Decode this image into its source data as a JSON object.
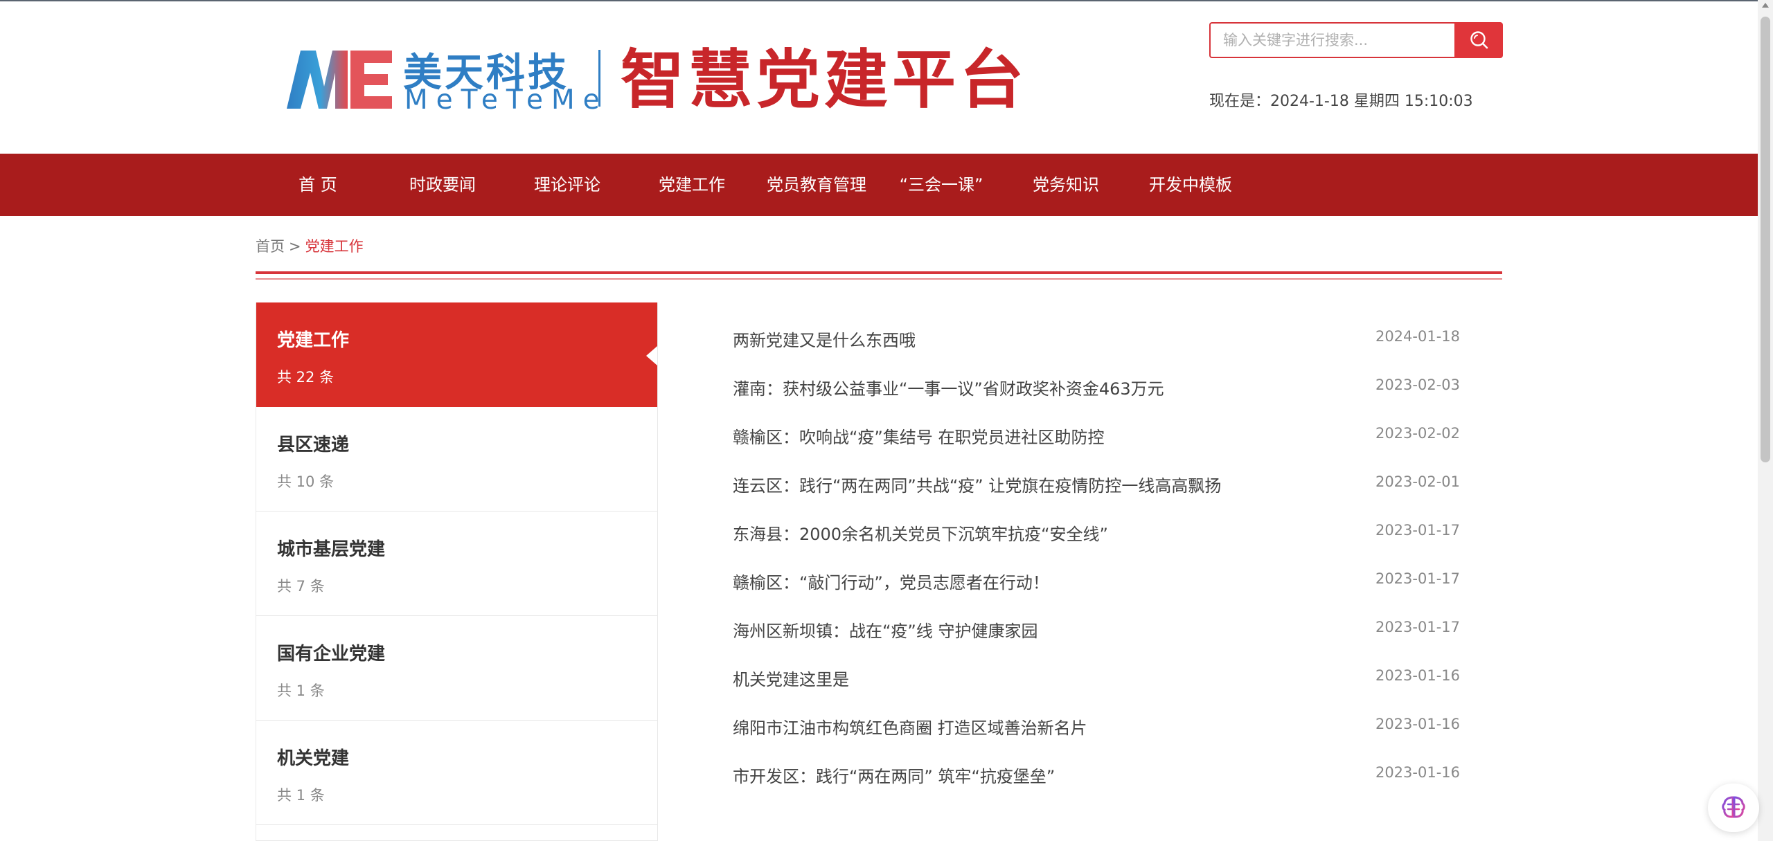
{
  "header": {
    "logo_cn": "美天科技",
    "logo_en": "MeTeTeMe",
    "platform_title": "智慧党建平台",
    "search_placeholder": "输入关键字进行搜索...",
    "datetime": "现在是：2024-1-18 星期四 15:10:03"
  },
  "nav": {
    "items": [
      "首 页",
      "时政要闻",
      "理论评论",
      "党建工作",
      "党员教育管理",
      "“三会一课”",
      "党务知识",
      "开发中模板"
    ]
  },
  "breadcrumb": {
    "home": "首页",
    "separator": ">",
    "current": "党建工作"
  },
  "sidebar": {
    "items": [
      {
        "title": "党建工作",
        "count": "共 22 条",
        "active": true
      },
      {
        "title": "县区速递",
        "count": "共 10 条",
        "active": false
      },
      {
        "title": "城市基层党建",
        "count": "共 7 条",
        "active": false
      },
      {
        "title": "国有企业党建",
        "count": "共 1 条",
        "active": false
      },
      {
        "title": "机关党建",
        "count": "共 1 条",
        "active": false
      }
    ]
  },
  "news": {
    "items": [
      {
        "title": "两新党建又是什么东西哦",
        "date": "2024-01-18"
      },
      {
        "title": "灌南：获村级公益事业“一事一议”省财政奖补资金463万元",
        "date": "2023-02-03"
      },
      {
        "title": "赣榆区：吹响战“疫”集结号 在职党员进社区助防控",
        "date": "2023-02-02"
      },
      {
        "title": "连云区：践行“两在两同”共战“疫” 让党旗在疫情防控一线高高飘扬",
        "date": "2023-02-01"
      },
      {
        "title": "东海县：2000余名机关党员下沉筑牢抗疫“安全线”",
        "date": "2023-01-17"
      },
      {
        "title": "赣榆区：“敲门行动”，党员志愿者在行动！",
        "date": "2023-01-17"
      },
      {
        "title": "海州区新坝镇：战在“疫”线 守护健康家园",
        "date": "2023-01-17"
      },
      {
        "title": "机关党建这里是",
        "date": "2023-01-16"
      },
      {
        "title": "绵阳市江油市构筑红色商圈 打造区域善治新名片",
        "date": "2023-01-16"
      },
      {
        "title": "市开发区：践行“两在两同” 筑牢“抗疫堡垒”",
        "date": "2023-01-16"
      }
    ]
  },
  "colors": {
    "brand_red": "#a91c1c",
    "accent_red": "#d92d27",
    "logo_blue": "#2f7ec4"
  },
  "icons": {
    "search": "search-icon",
    "logo": "logo-mark-icon",
    "assistant": "ai-assistant-icon"
  }
}
